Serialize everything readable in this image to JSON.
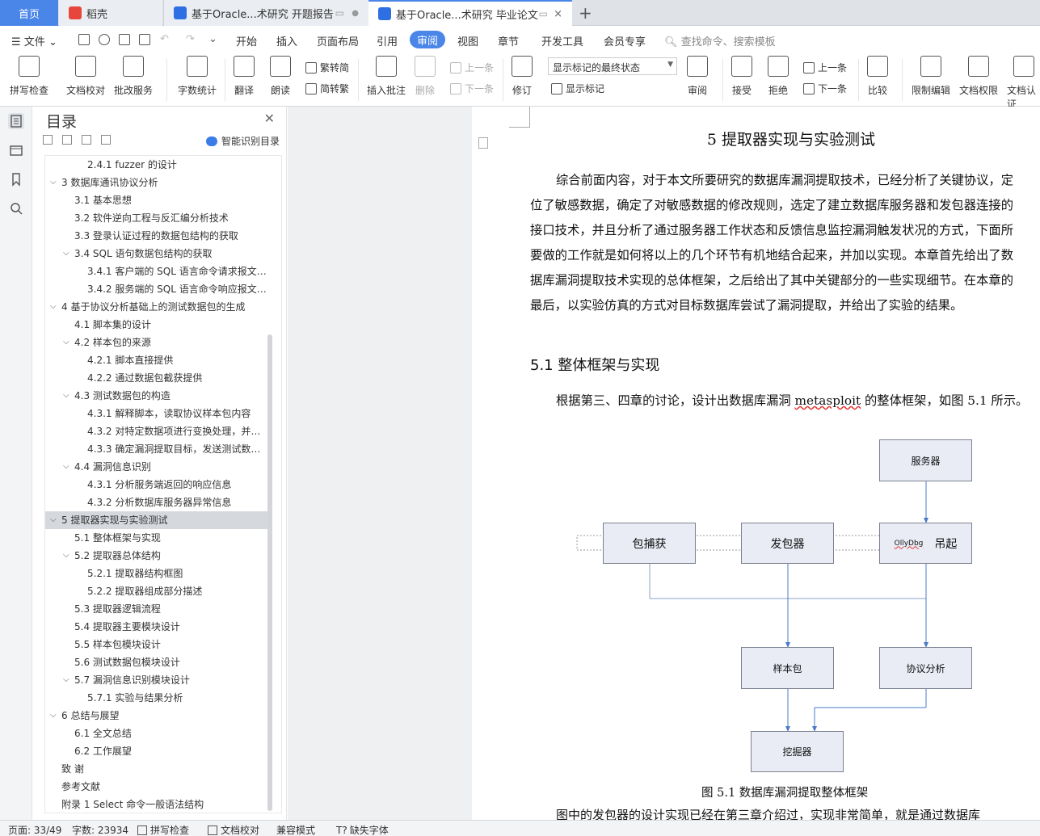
{
  "tabs": {
    "home": "首页",
    "shell": "稻壳",
    "doc1": "基于Oracle...术研究 开题报告",
    "doc2": "基于Oracle...术研究 毕业论文"
  },
  "menu": {
    "file": "文件",
    "items": [
      "开始",
      "插入",
      "页面布局",
      "引用",
      "审阅",
      "视图",
      "章节",
      "开发工具",
      "会员专享"
    ],
    "active": "审阅",
    "search": "查找命令、搜索模板"
  },
  "ribbon": {
    "spellcheck": "拼写检查",
    "doc_proof": "文档校对",
    "batch_service": "批改服务",
    "word_count": "字数统计",
    "translate": "翻译",
    "read_aloud": "朗读",
    "trad_to_simp": "繁转简",
    "simp_to_trad": "简转繁",
    "insert_comment": "插入批注",
    "delete": "删除",
    "prev_comment": "上一条",
    "next_comment": "下一条",
    "revise": "修订",
    "markup_state": "显示标记的最终状态",
    "show_markup": "显示标记",
    "review_pane": "审阅",
    "accept": "接受",
    "reject": "拒绝",
    "prev_change": "上一条",
    "next_change": "下一条",
    "compare": "比较",
    "restrict_edit": "限制编辑",
    "doc_permission": "文档权限",
    "doc_cert": "文档认证"
  },
  "toc": {
    "title": "目录",
    "smart": "智能识别目录",
    "items": [
      {
        "text": "2.4.1 fuzzer 的设计",
        "level": 3
      },
      {
        "text": "3 数据库通讯协议分析",
        "level": 1,
        "arrow": true
      },
      {
        "text": "3.1 基本思想",
        "level": 2
      },
      {
        "text": "3.2 软件逆向工程与反汇编分析技术",
        "level": 2
      },
      {
        "text": "3.3 登录认证过程的数据包结构的获取",
        "level": 2
      },
      {
        "text": "3.4 SQL 语句数据包结构的获取",
        "level": 2,
        "arrow": true
      },
      {
        "text": "3.4.1 客户端的 SQL 语言命令请求报文数据格式",
        "level": 3
      },
      {
        "text": "3.4.2 服务端的 SQL 语言命令响应报文数据格式",
        "level": 3
      },
      {
        "text": "4 基于协议分析基础上的测试数据包的生成",
        "level": 1,
        "arrow": true
      },
      {
        "text": "4.1 脚本集的设计",
        "level": 2
      },
      {
        "text": "4.2 样本包的来源",
        "level": 2,
        "arrow": true
      },
      {
        "text": "4.2.1 脚本直接提供",
        "level": 3
      },
      {
        "text": "4.2.2 通过数据包截获提供",
        "level": 3
      },
      {
        "text": "4.3 测试数据包的构造",
        "level": 2,
        "arrow": true
      },
      {
        "text": "4.3.1 解释脚本，读取协议样本包内容",
        "level": 3
      },
      {
        "text": "4.3.2 对特定数据项进行变换处理，并构造测试数据包",
        "level": 3
      },
      {
        "text": "4.3.3 确定漏洞提取目标，发送测试数据包到服务器",
        "level": 3
      },
      {
        "text": "4.4 漏洞信息识别",
        "level": 2,
        "arrow": true
      },
      {
        "text": "4.3.1 分析服务端返回的响应信息",
        "level": 3
      },
      {
        "text": "4.3.2 分析数据库服务器异常信息",
        "level": 3
      },
      {
        "text": "5 提取器实现与实验测试",
        "level": 1,
        "arrow": true,
        "selected": true
      },
      {
        "text": "5.1 整体框架与实现",
        "level": 2
      },
      {
        "text": "5.2 提取器总体结构",
        "level": 2,
        "arrow": true
      },
      {
        "text": "5.2.1 提取器结构框图",
        "level": 3
      },
      {
        "text": "5.2.2 提取器组成部分描述",
        "level": 3
      },
      {
        "text": "5.3 提取器逻辑流程",
        "level": 2
      },
      {
        "text": "5.4 提取器主要模块设计",
        "level": 2
      },
      {
        "text": "5.5 样本包模块设计",
        "level": 2
      },
      {
        "text": "5.6 测试数据包模块设计",
        "level": 2
      },
      {
        "text": "5.7 漏洞信息识别模块设计",
        "level": 2,
        "arrow": true
      },
      {
        "text": "5.7.1 实验与结果分析",
        "level": 3
      },
      {
        "text": "6 总结与展望",
        "level": 1,
        "arrow": true
      },
      {
        "text": "6.1 全文总结",
        "level": 2
      },
      {
        "text": "6.2 工作展望",
        "level": 2
      },
      {
        "text": "致 谢",
        "level": 1
      },
      {
        "text": "参考文献",
        "level": 1
      },
      {
        "text": "附录 1 Select 命令一般语法结构",
        "level": 1
      }
    ]
  },
  "document": {
    "chapter_title": "5 提取器实现与实验测试",
    "para1": "综合前面内容，对于本文所要研究的数据库漏洞提取技术，已经分析了关键协议，定位了敏感数据，确定了对敏感数据的修改规则，选定了建立数据库服务器和发包器连接的接口技术，并且分析了通过服务器工作状态和反馈信息监控漏洞触发状况的方式，下面所要做的工作就是如何将以上的几个环节有机地结合起来，并加以实现。本章首先给出了数据库漏洞提取技术实现的总体框架，之后给出了其中关键部分的一些实现细节。在本章的最后，以实验仿真的方式对目标数据库尝试了漏洞提取，并给出了实验的结果。",
    "section_title": "5.1 整体框架与实现",
    "para2_a": "根据第三、四章的讨论，设计出数据库漏洞 ",
    "para2_b": "metasploit",
    "para2_c": " 的整体框架，如图 5.1 所示。",
    "diagram": {
      "server": "服务器",
      "capture": "包捕获",
      "sender": "发包器",
      "ollydbg": "OllyDbg",
      "hook": "吊起",
      "sample": "样本包",
      "protocol": "协议分析",
      "miner": "挖掘器"
    },
    "caption": "图 5.1  数据库漏洞提取整体框架",
    "cut_line": "图中的发包器的设计实现已经在第三章介绍过，实现非常简单，就是通过数据库"
  },
  "status": {
    "page": "页面: 33/49",
    "words": "字数: 23934",
    "spell": "拼写检查",
    "proof": "文档校对",
    "compat": "兼容模式",
    "missing_font": "缺失字体"
  }
}
